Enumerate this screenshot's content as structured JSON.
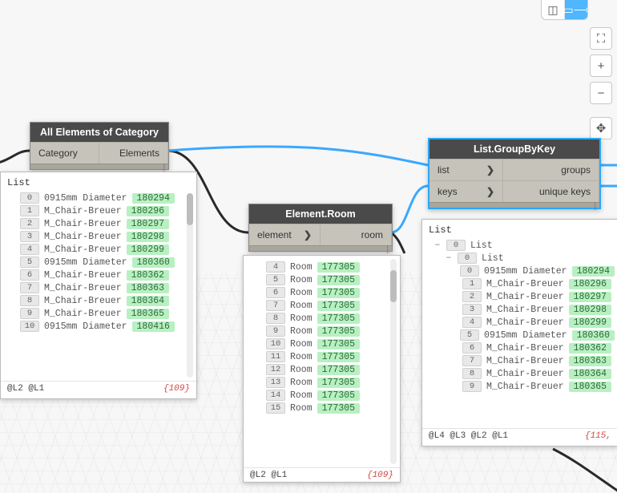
{
  "toolbar": {
    "view3d_icon": "◫",
    "preview_icon": "▭⟶",
    "fit_icon": "⛶",
    "plus": "+",
    "minus": "−",
    "pan": "✥"
  },
  "nodes": {
    "allElements": {
      "title": "All Elements of Category",
      "in": "Category",
      "out": "Elements"
    },
    "elementRoom": {
      "title": "Element.Room",
      "in": "element",
      "out": "room",
      "caret": "❯"
    },
    "groupByKey": {
      "title": "List.GroupByKey",
      "in1": "list",
      "in2": "keys",
      "out1": "groups",
      "out2": "unique keys",
      "caret": "❯"
    }
  },
  "watch_left": {
    "title": "List",
    "levels": "@L2 @L1",
    "count": "{109}",
    "rows": [
      {
        "i": "0",
        "label": "0915mm Diameter",
        "id": "180294"
      },
      {
        "i": "1",
        "label": "M_Chair-Breuer",
        "id": "180296"
      },
      {
        "i": "2",
        "label": "M_Chair-Breuer",
        "id": "180297"
      },
      {
        "i": "3",
        "label": "M_Chair-Breuer",
        "id": "180298"
      },
      {
        "i": "4",
        "label": "M_Chair-Breuer",
        "id": "180299"
      },
      {
        "i": "5",
        "label": "0915mm Diameter",
        "id": "180360"
      },
      {
        "i": "6",
        "label": "M_Chair-Breuer",
        "id": "180362"
      },
      {
        "i": "7",
        "label": "M_Chair-Breuer",
        "id": "180363"
      },
      {
        "i": "8",
        "label": "M_Chair-Breuer",
        "id": "180364"
      },
      {
        "i": "9",
        "label": "M_Chair-Breuer",
        "id": "180365"
      },
      {
        "i": "10",
        "label": "0915mm Diameter",
        "id": "180416"
      }
    ]
  },
  "watch_mid": {
    "levels": "@L2 @L1",
    "count": "{109}",
    "rows": [
      {
        "i": "4",
        "label": "Room",
        "id": "177305"
      },
      {
        "i": "5",
        "label": "Room",
        "id": "177305"
      },
      {
        "i": "6",
        "label": "Room",
        "id": "177305"
      },
      {
        "i": "7",
        "label": "Room",
        "id": "177305"
      },
      {
        "i": "8",
        "label": "Room",
        "id": "177305"
      },
      {
        "i": "9",
        "label": "Room",
        "id": "177305"
      },
      {
        "i": "10",
        "label": "Room",
        "id": "177305"
      },
      {
        "i": "11",
        "label": "Room",
        "id": "177305"
      },
      {
        "i": "12",
        "label": "Room",
        "id": "177305"
      },
      {
        "i": "13",
        "label": "Room",
        "id": "177305"
      },
      {
        "i": "14",
        "label": "Room",
        "id": "177305"
      },
      {
        "i": "15",
        "label": "Room",
        "id": "177305"
      }
    ]
  },
  "watch_right": {
    "title": "List",
    "levels": "@L4 @L3 @L2 @L1",
    "count": "{115,",
    "head1_idx": "0",
    "head1_label": "List",
    "head2_idx": "0",
    "head2_label": "List",
    "rows": [
      {
        "i": "0",
        "label": "0915mm Diameter",
        "id": "180294"
      },
      {
        "i": "1",
        "label": "M_Chair-Breuer",
        "id": "180296"
      },
      {
        "i": "2",
        "label": "M_Chair-Breuer",
        "id": "180297"
      },
      {
        "i": "3",
        "label": "M_Chair-Breuer",
        "id": "180298"
      },
      {
        "i": "4",
        "label": "M_Chair-Breuer",
        "id": "180299"
      },
      {
        "i": "5",
        "label": "0915mm Diameter",
        "id": "180360"
      },
      {
        "i": "6",
        "label": "M_Chair-Breuer",
        "id": "180362"
      },
      {
        "i": "7",
        "label": "M_Chair-Breuer",
        "id": "180363"
      },
      {
        "i": "8",
        "label": "M_Chair-Breuer",
        "id": "180364"
      },
      {
        "i": "9",
        "label": "M_Chair-Breuer",
        "id": "180365"
      }
    ]
  }
}
